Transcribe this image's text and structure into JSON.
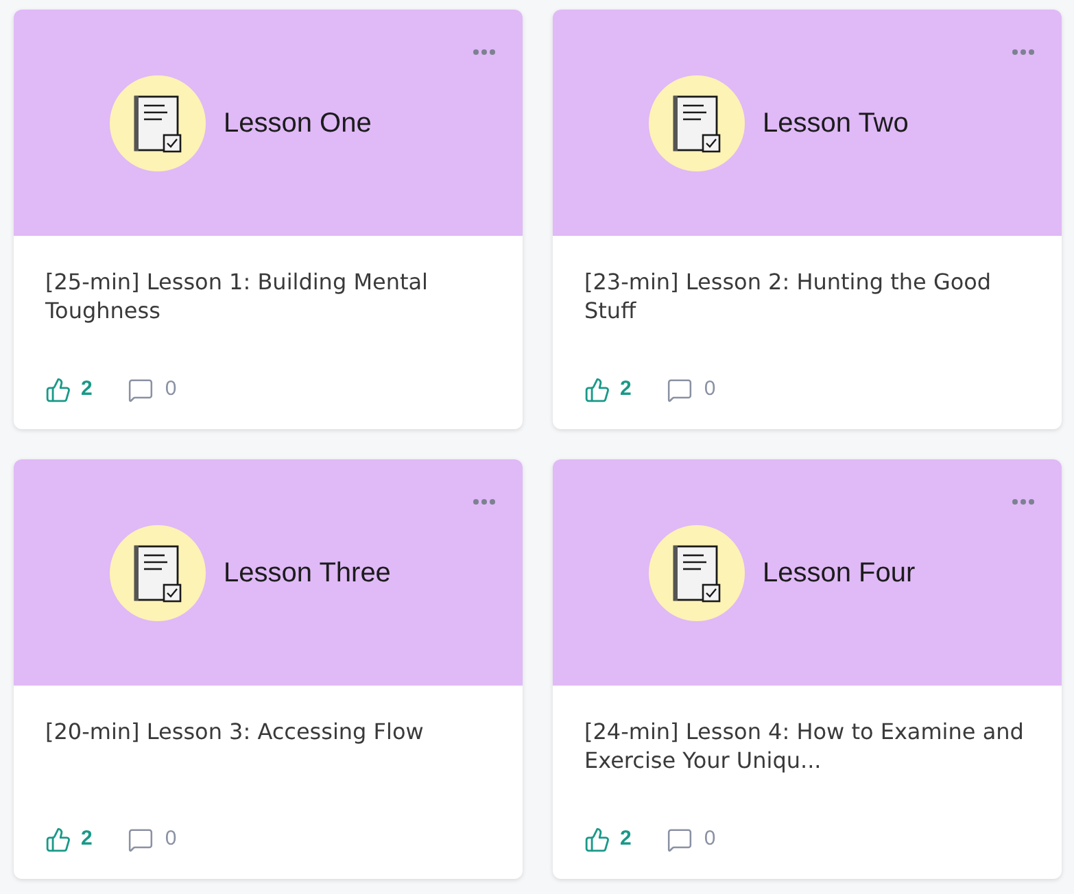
{
  "cards": [
    {
      "banner_title": "Lesson One",
      "title": "[25-min] Lesson 1: Building Mental Toughness",
      "likes": "2",
      "comments": "0"
    },
    {
      "banner_title": "Lesson Two",
      "title": "[23-min] Lesson 2: Hunting the Good Stuff",
      "likes": "2",
      "comments": "0"
    },
    {
      "banner_title": "Lesson Three",
      "title": "[20-min] Lesson 3: Accessing Flow",
      "likes": "2",
      "comments": "0"
    },
    {
      "banner_title": "Lesson Four",
      "title": "[24-min] Lesson 4: How to Examine and Exercise Your Uniqu...",
      "likes": "2",
      "comments": "0"
    }
  ]
}
